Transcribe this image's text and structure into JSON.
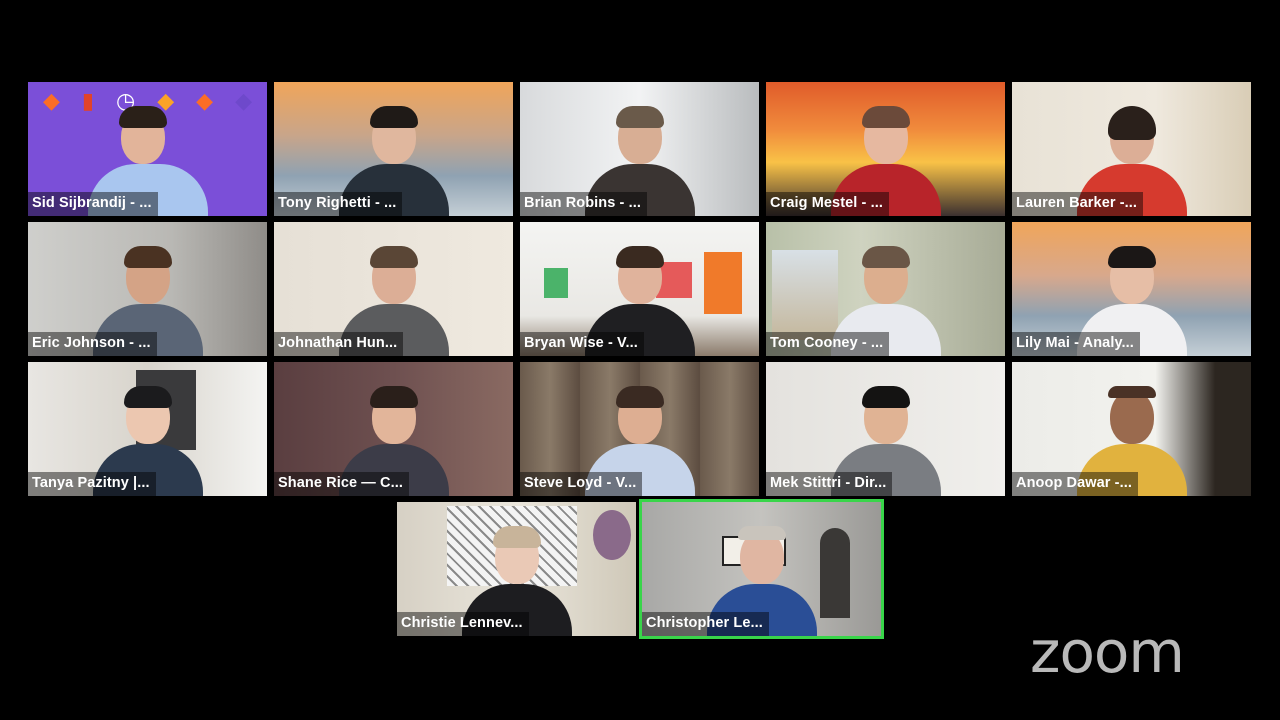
{
  "app": {
    "brand_logo_text": "zoom",
    "active_speaker": "Christopher Le..."
  },
  "colors": {
    "background": "#000000",
    "active_speaker_border": "#39d54a",
    "label_text": "#ffffff",
    "logo_gray": "#b9b9b9"
  },
  "participants": [
    {
      "label": "Sid Sijbrandij - ..."
    },
    {
      "label": "Tony Righetti - ..."
    },
    {
      "label": "Brian Robins - ..."
    },
    {
      "label": "Craig Mestel - ..."
    },
    {
      "label": "Lauren Barker -..."
    },
    {
      "label": "Eric Johnson - ..."
    },
    {
      "label": "Johnathan Hun..."
    },
    {
      "label": "Bryan Wise - V..."
    },
    {
      "label": "Tom Cooney - ..."
    },
    {
      "label": "Lily Mai - Analy..."
    },
    {
      "label": "Tanya Pazitny |..."
    },
    {
      "label": "Shane Rice — C..."
    },
    {
      "label": "Steve Loyd - V..."
    },
    {
      "label": "Mek Stittri - Dir..."
    },
    {
      "label": "Anoop Dawar -..."
    },
    {
      "label": "Christie Lennev..."
    },
    {
      "label": "Christopher Le..."
    }
  ],
  "icons": {
    "tanuki_logo": "tanuki-logo-icon",
    "clock": "clock-icon"
  }
}
